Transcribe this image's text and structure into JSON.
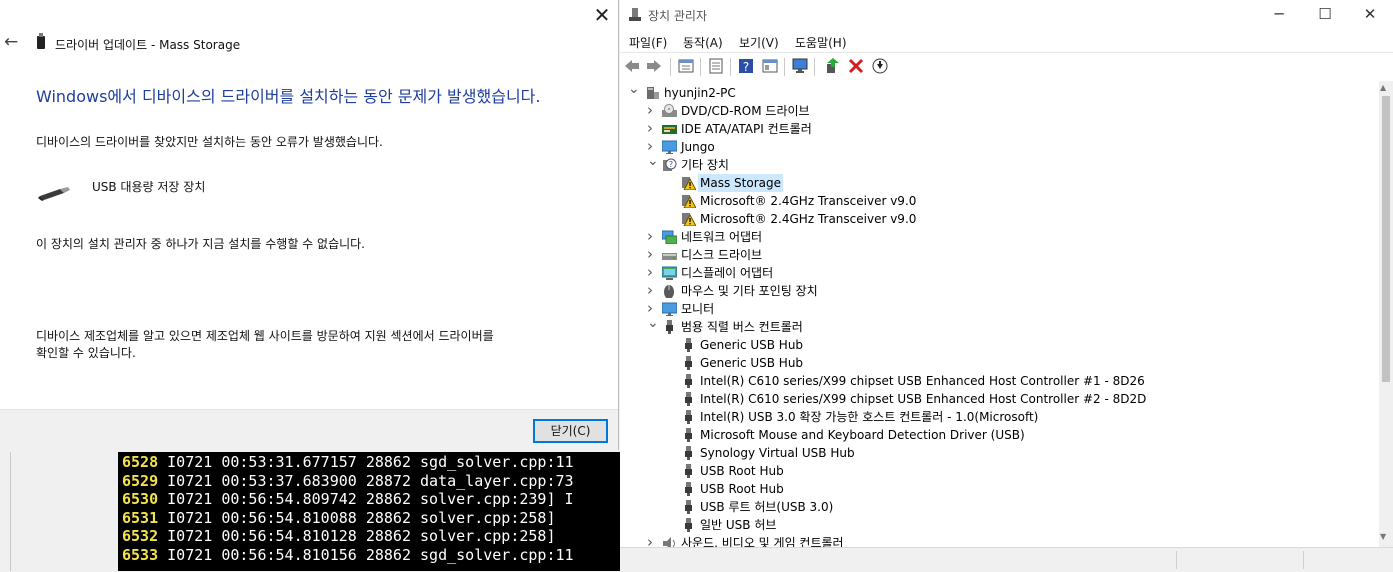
{
  "terminal": {
    "lines": [
      {
        "num": "6528",
        "text": "I0721 00:53:31.677157 28862 sgd_solver.cpp:11"
      },
      {
        "num": "6529",
        "text": "I0721 00:53:37.683900 28872 data_layer.cpp:73"
      },
      {
        "num": "6530",
        "text": "I0721 00:56:54.809742 28862 solver.cpp:239] I"
      },
      {
        "num": "6531",
        "text": "I0721 00:56:54.810088 28862 solver.cpp:258]"
      },
      {
        "num": "6532",
        "text": "I0721 00:56:54.810128 28862 solver.cpp:258]"
      },
      {
        "num": "6533",
        "text": "I0721 00:56:54.810156 28862 sgd_solver.cpp:11"
      }
    ]
  },
  "driver_dialog": {
    "close_glyph": "✕",
    "back_glyph": "←",
    "title": "드라이버 업데이트 - Mass Storage",
    "heading": "Windows에서 디바이스의 드라이버를 설치하는 동안 문제가 발생했습니다.",
    "message": "디바이스의 드라이버를 찾았지만 설치하는 동안 오류가 발생했습니다.",
    "device_name": "USB 대용량 저장 장치",
    "error_detail": "이 장치의 설치 관리자 중 하나가 지금 설치를 수행할 수 없습니다.",
    "advice_line1": "디바이스 제조업체를 알고 있으면 제조업체 웹 사이트를 방문하여 지원 섹션에서 드라이버를",
    "advice_line2": "확인할 수 있습니다.",
    "close_button": "닫기(C)"
  },
  "device_manager": {
    "title": "장치 관리자",
    "window_buttons": {
      "minimize": "─",
      "maximize": "☐",
      "close": "✕"
    },
    "menu": [
      "파일(F)",
      "동작(A)",
      "보기(V)",
      "도움말(H)"
    ],
    "toolbar_icons": [
      "back-icon",
      "forward-icon",
      "properties-view-icon",
      "details-icon",
      "help-icon",
      "view-icon",
      "monitor-icon",
      "update-driver-icon",
      "uninstall-icon",
      "download-icon"
    ],
    "tree": {
      "root": "hyunjin2-PC",
      "categories": [
        {
          "label": "DVD/CD-ROM 드라이브",
          "icon": "dvd-icon",
          "expanded": false
        },
        {
          "label": "IDE ATA/ATAPI 컨트롤러",
          "icon": "ide-icon",
          "expanded": false
        },
        {
          "label": "Jungo",
          "icon": "monitor-icon",
          "expanded": false
        },
        {
          "label": "기타 장치",
          "icon": "unknown-device-icon",
          "expanded": true,
          "children": [
            {
              "label": "Mass Storage",
              "icon": "warning-device-icon",
              "selected": true
            },
            {
              "label": "Microsoft® 2.4GHz Transceiver v9.0",
              "icon": "warning-device-icon"
            },
            {
              "label": "Microsoft® 2.4GHz Transceiver v9.0",
              "icon": "warning-device-icon"
            }
          ]
        },
        {
          "label": "네트워크 어댑터",
          "icon": "network-icon",
          "expanded": false
        },
        {
          "label": "디스크 드라이브",
          "icon": "disk-icon",
          "expanded": false
        },
        {
          "label": "디스플레이 어댑터",
          "icon": "display-icon",
          "expanded": false
        },
        {
          "label": "마우스 및 기타 포인팅 장치",
          "icon": "mouse-icon",
          "expanded": false
        },
        {
          "label": "모니터",
          "icon": "monitor-icon",
          "expanded": false
        },
        {
          "label": "범용 직렬 버스 컨트롤러",
          "icon": "usb-icon",
          "expanded": true,
          "children": [
            {
              "label": "Generic USB Hub",
              "icon": "usb-icon"
            },
            {
              "label": "Generic USB Hub",
              "icon": "usb-icon"
            },
            {
              "label": "Intel(R) C610 series/X99 chipset USB Enhanced Host Controller #1 - 8D26",
              "icon": "usb-icon"
            },
            {
              "label": "Intel(R) C610 series/X99 chipset USB Enhanced Host Controller #2 - 8D2D",
              "icon": "usb-icon"
            },
            {
              "label": "Intel(R) USB 3.0 확장 가능한 호스트 컨트롤러 - 1.0(Microsoft)",
              "icon": "usb-icon"
            },
            {
              "label": "Microsoft Mouse and Keyboard Detection Driver (USB)",
              "icon": "usb-icon"
            },
            {
              "label": "Synology Virtual USB Hub",
              "icon": "usb-icon"
            },
            {
              "label": "USB Root Hub",
              "icon": "usb-icon"
            },
            {
              "label": "USB Root Hub",
              "icon": "usb-icon"
            },
            {
              "label": "USB 루트 허브(USB 3.0)",
              "icon": "usb-icon"
            },
            {
              "label": "일반 USB 허브",
              "icon": "usb-icon"
            }
          ]
        },
        {
          "label": "사운드, 비디오 및 게임 컨트롤러",
          "icon": "sound-icon",
          "expanded": false
        }
      ]
    },
    "colors": {
      "selection": "#cce8ff",
      "heading_blue": "#1e3e9e",
      "focus_blue": "#0078d7"
    }
  }
}
